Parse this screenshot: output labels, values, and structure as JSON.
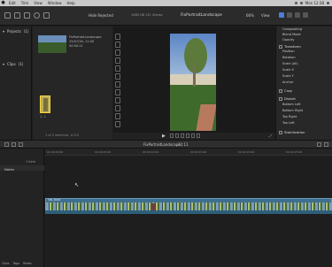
{
  "menubar": {
    "items": [
      "Edit",
      "Trim",
      "View",
      "Window",
      "Help"
    ],
    "clock": "Mon 12:38"
  },
  "toolbar": {
    "hide_rejected": "Hide Rejected",
    "format": "1080 HD 25i, Stereo",
    "viewer_title": "FixPortraitLandscape",
    "zoom": "66%",
    "view": "View"
  },
  "libraries": {
    "projects_label": "Projects",
    "projects_count": "(1)",
    "clips_label": "Clips",
    "clips_count": "(1)"
  },
  "browser": {
    "clip_name": "FixPortraitLandscape",
    "clip_date": "25/07/16, 11:00",
    "clip_duration": "00:00:11",
    "film_label": "1, 1",
    "status": "1 of 2 selected, 10:15"
  },
  "inspector": {
    "rows_top": [
      "Compositing",
      "Blend Mode",
      "Opacity"
    ],
    "transform_label": "Transform",
    "transform_rows": [
      "Position",
      "Rotation",
      "Scale (All)",
      "Scale X",
      "Scale Y",
      "Anchor"
    ],
    "crop_label": "Crop",
    "distort_label": "Distort",
    "distort_rows": [
      "Bottom Left",
      "Bottom Right",
      "Top Right",
      "Top Left"
    ],
    "stabilization_label": "Stabilization"
  },
  "timeline": {
    "title": "FixPortraitLandscape",
    "timecode": "12:11",
    "index_item": "1 item",
    "notes_header": "Notes",
    "clip_label": "VID_0001",
    "tabs": [
      "Clips",
      "Tags",
      "Roles"
    ],
    "ruler_ticks": [
      "00:00:00:00",
      "00:00:05:00",
      "00:00:10:00",
      "00:00:15:00",
      "00:00:20:00",
      "00:00:25:00"
    ]
  },
  "colors": {
    "accent": "#4a7fd8",
    "clip_blue": "#3f6f8f",
    "selection_yellow": "#ffd23a"
  }
}
